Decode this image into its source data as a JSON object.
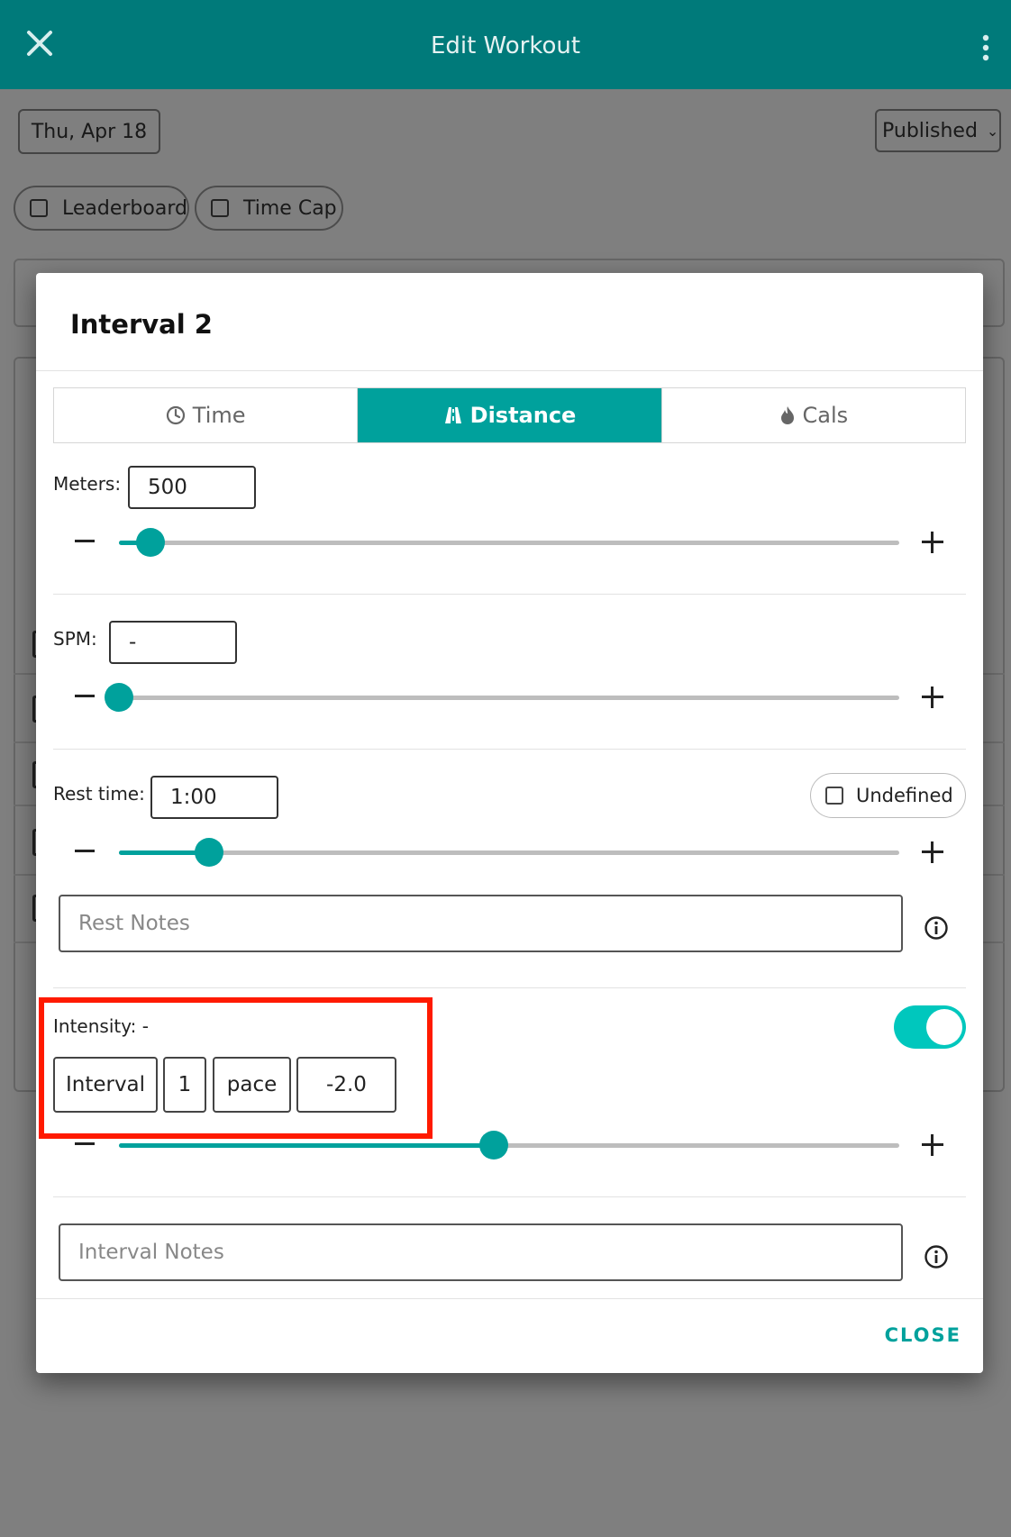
{
  "appbar": {
    "title": "Edit Workout"
  },
  "toolbar": {
    "date": "Thu, Apr 18",
    "status": "Published"
  },
  "options": {
    "leaderboard": "Leaderboard",
    "time_cap": "Time Cap"
  },
  "modal": {
    "title": "Interval 2",
    "tabs": [
      {
        "label": "Time",
        "icon": "clock-icon",
        "active": false
      },
      {
        "label": "Distance",
        "icon": "road-icon",
        "active": true
      },
      {
        "label": "Cals",
        "icon": "flame-icon",
        "active": false
      }
    ],
    "meters": {
      "label": "Meters:",
      "value": "500",
      "slider_fraction": 0.04
    },
    "spm": {
      "label": "SPM:",
      "value": "-",
      "slider_fraction": 0.0
    },
    "rest": {
      "label": "Rest time:",
      "value": "1:00",
      "slider_fraction": 0.115,
      "undefined_label": "Undefined",
      "notes_placeholder": "Rest Notes"
    },
    "intensity": {
      "label": "Intensity: -",
      "type": "Interval",
      "number": "1",
      "unit": "pace",
      "offset": "-2.0",
      "enabled": true,
      "slider_fraction": 0.48
    },
    "interval_notes_placeholder": "Interval Notes",
    "close_label": "CLOSE"
  },
  "colors": {
    "accent": "#00a19c",
    "appbar": "#007a7a",
    "highlight": "#ff1a00"
  }
}
